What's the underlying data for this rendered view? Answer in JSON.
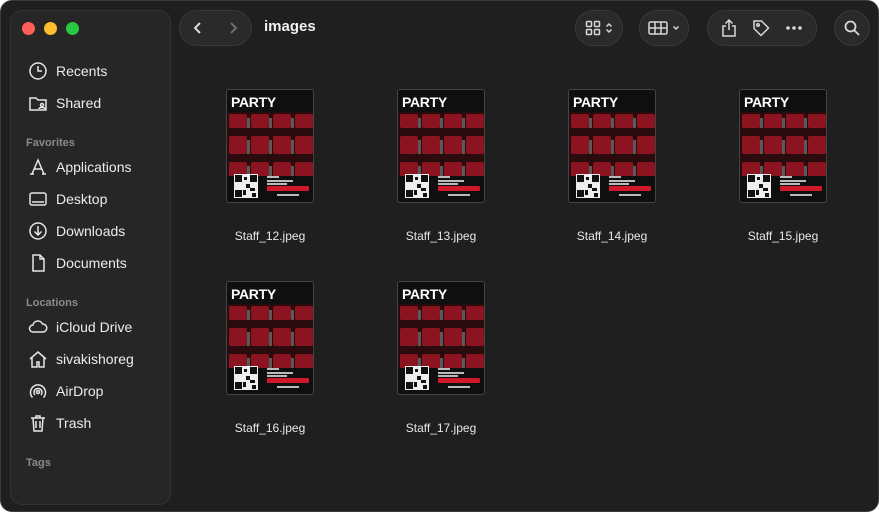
{
  "window": {
    "title": "images"
  },
  "sidebar": {
    "recents": "Recents",
    "shared": "Shared",
    "favorites_heading": "Favorites",
    "favorites": [
      "Applications",
      "Desktop",
      "Downloads",
      "Documents"
    ],
    "locations_heading": "Locations",
    "locations": [
      "iCloud Drive",
      "sivakishoreg",
      "AirDrop",
      "Trash"
    ],
    "tags_heading": "Tags"
  },
  "toolbar": {
    "icons": [
      "chevron-left-icon",
      "chevron-right-icon",
      "grid-view-icon",
      "group-icon",
      "share-icon",
      "tag-icon",
      "more-icon",
      "search-icon"
    ]
  },
  "files": [
    {
      "name": "Staff_12.jpeg",
      "thumb_title": "PARTY"
    },
    {
      "name": "Staff_13.jpeg",
      "thumb_title": "PARTY"
    },
    {
      "name": "Staff_14.jpeg",
      "thumb_title": "PARTY"
    },
    {
      "name": "Staff_15.jpeg",
      "thumb_title": "PARTY"
    },
    {
      "name": "Staff_16.jpeg",
      "thumb_title": "PARTY"
    },
    {
      "name": "Staff_17.jpeg",
      "thumb_title": "PARTY"
    }
  ],
  "colors": {
    "window_bg": "#1f1f1f",
    "sidebar_bg": "#262626",
    "seat_red": "#8b1420",
    "ticket_red": "#d0182a"
  }
}
